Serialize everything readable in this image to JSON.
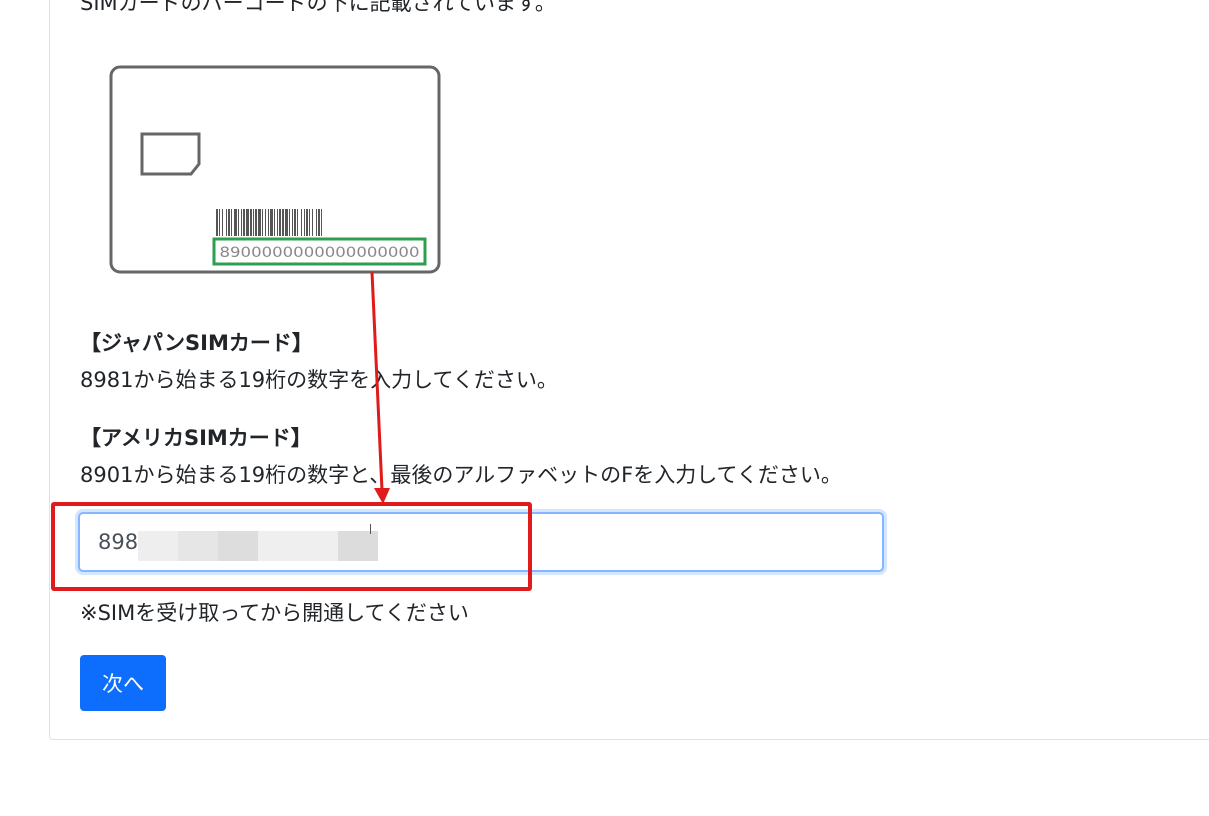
{
  "intro_text": "SIMカードのバーコードの下に記載されています。",
  "sim_card": {
    "number": "8900000000000000000"
  },
  "japan": {
    "heading": "【ジャパンSIMカード】",
    "description": "8981から始まる19桁の数字を入力してください。"
  },
  "america": {
    "heading": "【アメリカSIMカード】",
    "description": "8901から始まる19桁の数字と、最後のアルファベットのFを入力してください。"
  },
  "iccid_input": {
    "value": "898"
  },
  "note": "※SIMを受け取ってから開通してください",
  "next_button": "次へ",
  "colors": {
    "primary": "#0d6efd",
    "highlight_red": "#e01b1b",
    "number_frame_green": "#2e9e4f"
  }
}
